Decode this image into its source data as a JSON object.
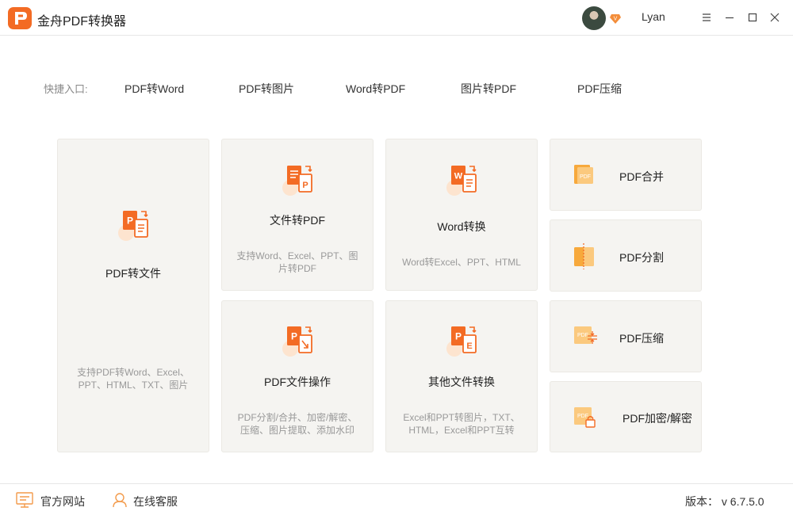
{
  "app": {
    "title": "金舟PDF转换器"
  },
  "user": {
    "name": "Lyan",
    "vip_icon": "vip-badge-icon"
  },
  "window_controls": [
    "menu-icon",
    "minimize-icon",
    "maximize-icon",
    "close-icon"
  ],
  "quick_entry": {
    "label": "快捷入口:",
    "items": [
      "PDF转Word",
      "PDF转图片",
      "Word转PDF",
      "图片转PDF",
      "PDF压缩"
    ]
  },
  "cards": {
    "pdf_to_file": {
      "title": "PDF转文件",
      "desc": "支持PDF转Word、Excel、PPT、HTML、TXT、图片"
    },
    "file_to_pdf": {
      "title": "文件转PDF",
      "desc": "支持Word、Excel、PPT、图片转PDF"
    },
    "word_convert": {
      "title": "Word转换",
      "desc": "Word转Excel、PPT、HTML"
    },
    "pdf_ops": {
      "title": "PDF文件操作",
      "desc": "PDF分割/合并、加密/解密、压缩、图片提取、添加水印"
    },
    "other_convert": {
      "title": "其他文件转换",
      "desc": "Excel和PPT转图片，TXT、HTML，Excel和PPT互转"
    }
  },
  "small_cards": [
    "PDF合并",
    "PDF分割",
    "PDF压缩",
    "PDF加密/解密"
  ],
  "footer": {
    "official_site": "官方网站",
    "online_service": "在线客服",
    "version": "版本： v 6.7.5.0"
  },
  "colors": {
    "accent": "#f36b24",
    "card_bg": "#f5f4f1",
    "icon_light": "#fbc97e",
    "icon_peach": "#fde4cf"
  }
}
